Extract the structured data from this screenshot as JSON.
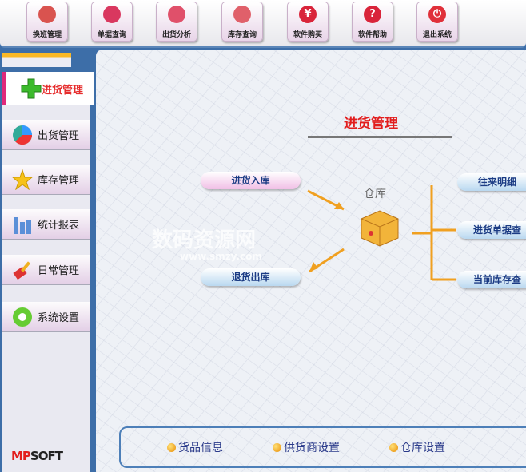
{
  "toolbar": [
    {
      "label": "换班管理",
      "icon": "users-icon",
      "color": "#d9534f"
    },
    {
      "label": "单据查询",
      "icon": "magnifier-icon",
      "color": "#d9375f"
    },
    {
      "label": "出货分析",
      "icon": "bar-chart-icon",
      "color": "#e0506a"
    },
    {
      "label": "库存查询",
      "icon": "boxes-icon",
      "color": "#e0606a"
    },
    {
      "label": "软件购买",
      "icon": "yen-icon",
      "color": "#d9243a",
      "glyph": "¥"
    },
    {
      "label": "软件帮助",
      "icon": "help-icon",
      "color": "#d9243a",
      "glyph": "?"
    },
    {
      "label": "退出系统",
      "icon": "power-icon",
      "color": "#e0303a",
      "glyph": "⏻"
    }
  ],
  "sidebar": {
    "active": {
      "label": "进货管理",
      "icon": "plus-icon"
    },
    "items": [
      {
        "label": "出货管理",
        "icon": "pie-chart-icon"
      },
      {
        "label": "库存管理",
        "icon": "star-icon"
      },
      {
        "label": "统计报表",
        "icon": "bar-chart-icon"
      },
      {
        "label": "日常管理",
        "icon": "brush-icon"
      },
      {
        "label": "系统设置",
        "icon": "gear-icon"
      }
    ],
    "logo": "MPSOFT"
  },
  "main": {
    "title": "进货管理",
    "in_stock": "进货入库",
    "return_out": "退货出库",
    "warehouse": "仓库",
    "right": [
      "往来明细",
      "进货单据查",
      "当前库存查"
    ],
    "bottom": [
      "货品信息",
      "供货商设置",
      "仓库设置"
    ]
  },
  "watermark": {
    "text": "数码资源网",
    "url": "www.smzy.com"
  },
  "colors": {
    "accent": "#e21e1e",
    "sidebar": "#3d6ea8",
    "link": "#1b3b84"
  }
}
